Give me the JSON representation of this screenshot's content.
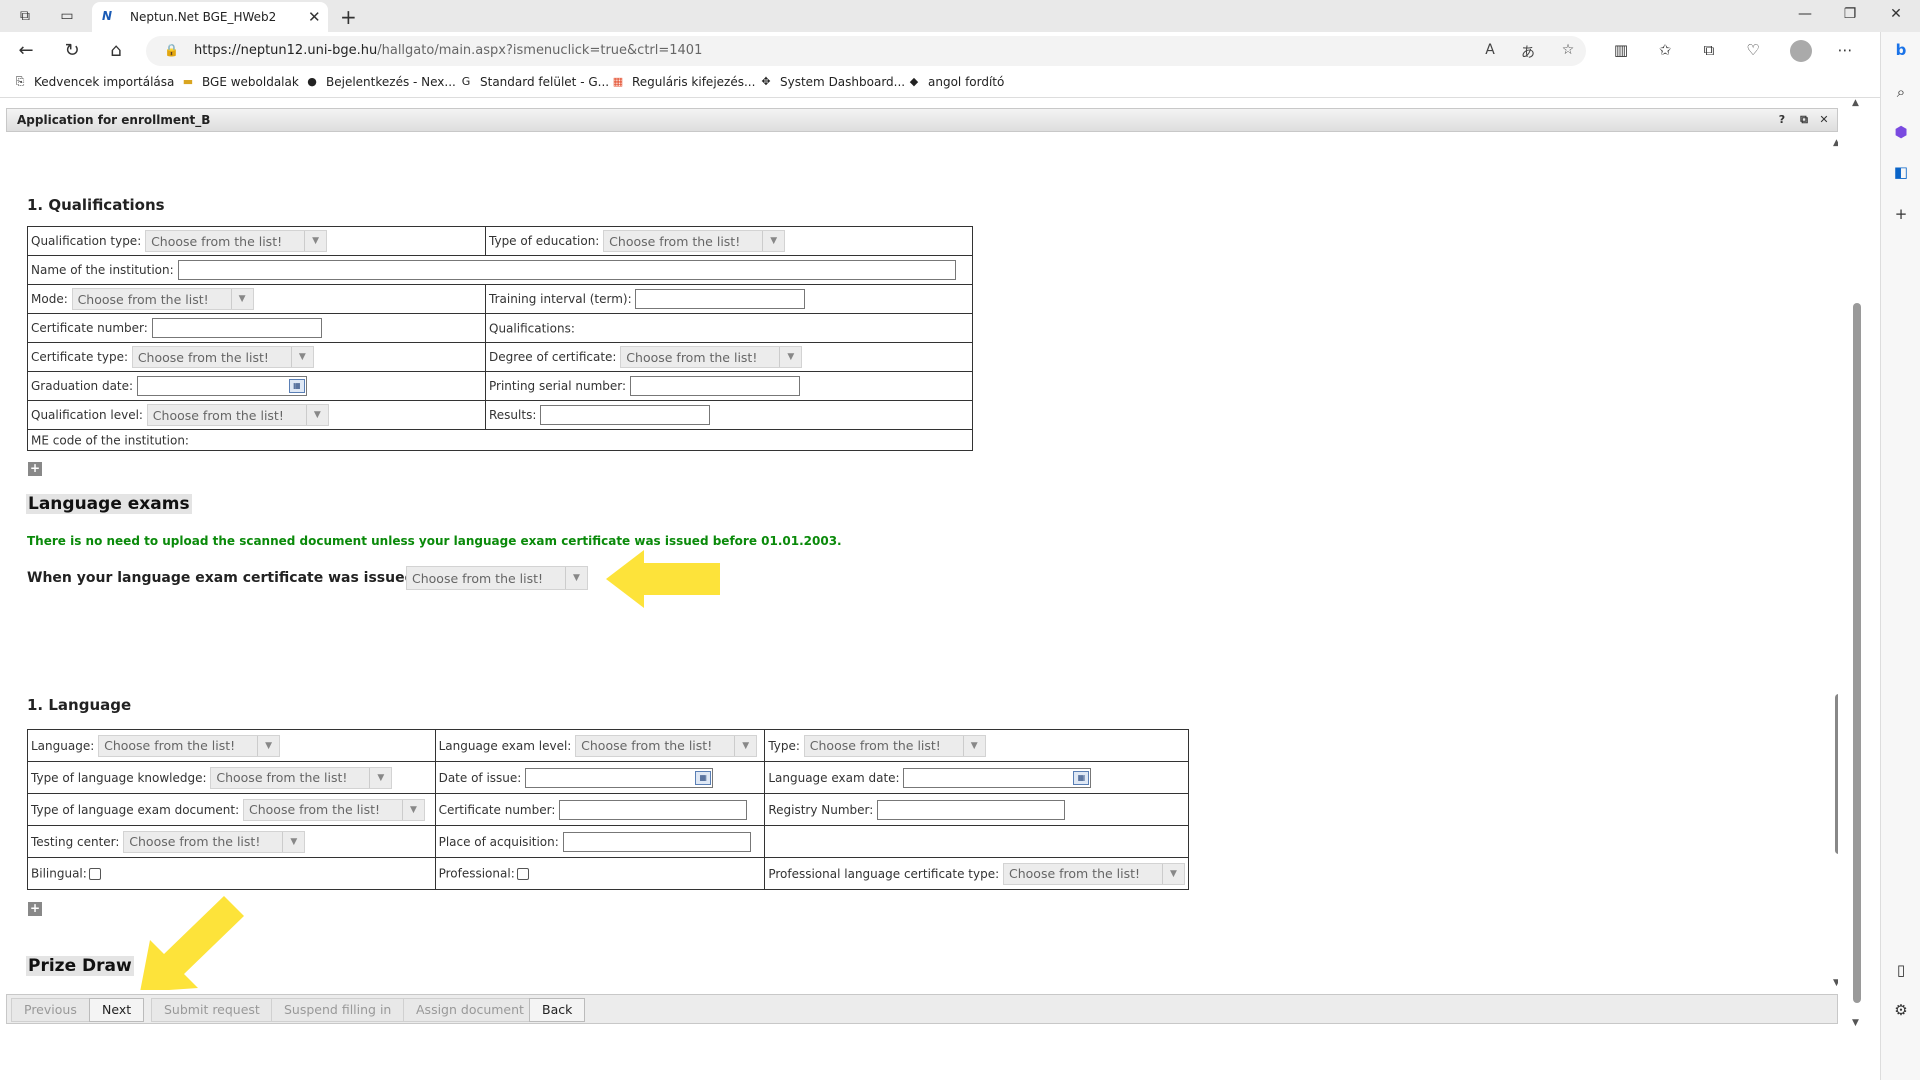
{
  "browser": {
    "tab_title": "Neptun.Net BGE_HWeb2",
    "url_host": "https://neptun12.uni-bge.hu",
    "url_path": "/hallgato/main.aspx?ismenuclick=true&ctrl=1401",
    "favorites": [
      "Kedvencek importálása",
      "BGE weboldalak",
      "Bejelentkezés - Nex...",
      "Standard felület - G...",
      "Reguláris kifejezés...",
      "System Dashboard...",
      "angol fordító"
    ]
  },
  "panel": {
    "title": "Application for enrollment_B",
    "help_icon": "?"
  },
  "qualifications": {
    "heading": "1. Qualifications",
    "qualification_type_label": "Qualification type:",
    "type_of_education_label": "Type of education:",
    "name_of_institution_label": "Name of the institution:",
    "mode_label": "Mode:",
    "training_interval_label": "Training interval (term):",
    "certificate_number_label": "Certificate number:",
    "qualifications_label": "Qualifications:",
    "certificate_type_label": "Certificate type:",
    "degree_of_certificate_label": "Degree of certificate:",
    "graduation_date_label": "Graduation date:",
    "printing_serial_label": "Printing serial number:",
    "qualification_level_label": "Qualification level:",
    "results_label": "Results:",
    "me_code_label": "ME code of the institution:"
  },
  "language_exams": {
    "heading": "Language exams",
    "notice": "There is no need to upload the scanned document unless your language exam certificate was issued before 01.01.2003.",
    "question": "When your language exam certificate was issued?"
  },
  "language": {
    "heading": "1. Language",
    "language_label": "Language:",
    "exam_level_label": "Language exam level:",
    "type_label": "Type:",
    "knowledge_type_label": "Type of language knowledge:",
    "date_of_issue_label": "Date of issue:",
    "exam_date_label": "Language exam date:",
    "exam_document_label": "Type of language exam document:",
    "certificate_number_label": "Certificate number:",
    "registry_number_label": "Registry Number:",
    "testing_center_label": "Testing center:",
    "place_of_acquisition_label": "Place of acquisition:",
    "bilingual_label": "Bilingual:",
    "professional_label": "Professional:",
    "professional_cert_type_label": "Professional language certificate type:"
  },
  "prize_draw": {
    "heading": "Prize Draw"
  },
  "common": {
    "choose": "Choose from the list!"
  },
  "footer": {
    "previous": "Previous",
    "next": "Next",
    "submit": "Submit request",
    "suspend": "Suspend filling in",
    "assign": "Assign document",
    "back": "Back"
  },
  "colors": {
    "notice_green": "#0a8a0a",
    "annotation_arrow": "#fde33a"
  }
}
